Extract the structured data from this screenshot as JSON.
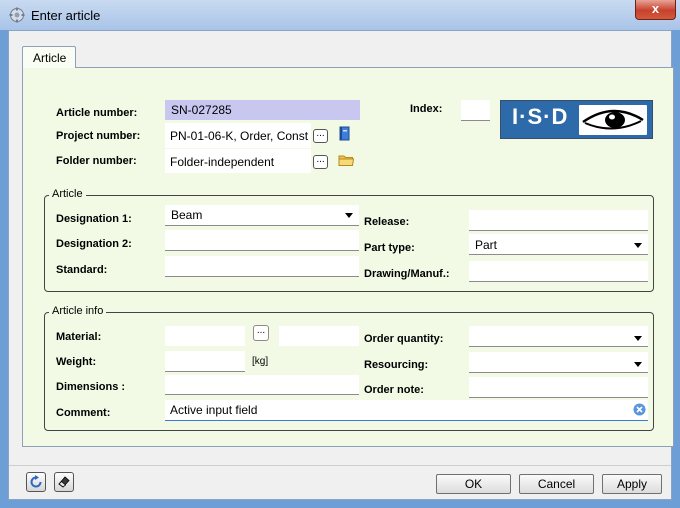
{
  "window": {
    "title": "Enter article",
    "close_label": "x"
  },
  "tabs": [
    {
      "label": "Article"
    }
  ],
  "header": {
    "article_number": {
      "label": "Article number:",
      "value": "SN-027285"
    },
    "project_number": {
      "label": "Project number:",
      "value": "PN-01-06-K, Order, Const",
      "button": "..."
    },
    "folder_number": {
      "label": "Folder number:",
      "value": "Folder-independent",
      "button": "..."
    },
    "index": {
      "label": "Index:",
      "value": ""
    },
    "logo": {
      "text": "I·S·D"
    }
  },
  "article_group": {
    "title": "Article",
    "designation1": {
      "label": "Designation 1:",
      "value": "Beam"
    },
    "designation2": {
      "label": "Designation 2:",
      "value": ""
    },
    "standard": {
      "label": "Standard:",
      "value": ""
    },
    "release": {
      "label": "Release:",
      "value": ""
    },
    "part_type": {
      "label": "Part type:",
      "value": "Part"
    },
    "drawing_manuf": {
      "label": "Drawing/Manuf.:",
      "value": ""
    }
  },
  "info_group": {
    "title": "Article info",
    "material": {
      "label": "Material:",
      "value": "",
      "button": "..."
    },
    "weight": {
      "label": "Weight:",
      "value": "",
      "unit": "[kg]"
    },
    "dimensions": {
      "label": "Dimensions :",
      "value": ""
    },
    "comment": {
      "label": "Comment:",
      "value": "Active input field"
    },
    "order_quantity": {
      "label": "Order quantity:",
      "value": ""
    },
    "resourcing": {
      "label": "Resourcing:",
      "value": ""
    },
    "order_note": {
      "label": "Order note:",
      "value": ""
    }
  },
  "buttons": {
    "ok": "OK",
    "cancel": "Cancel",
    "apply": "Apply"
  },
  "colors": {
    "panel_bg": "#f2fae6",
    "article_field_bg": "#c7c7f0",
    "accent": "#2d6aaa",
    "comment_underline": "#3b7bd5"
  }
}
